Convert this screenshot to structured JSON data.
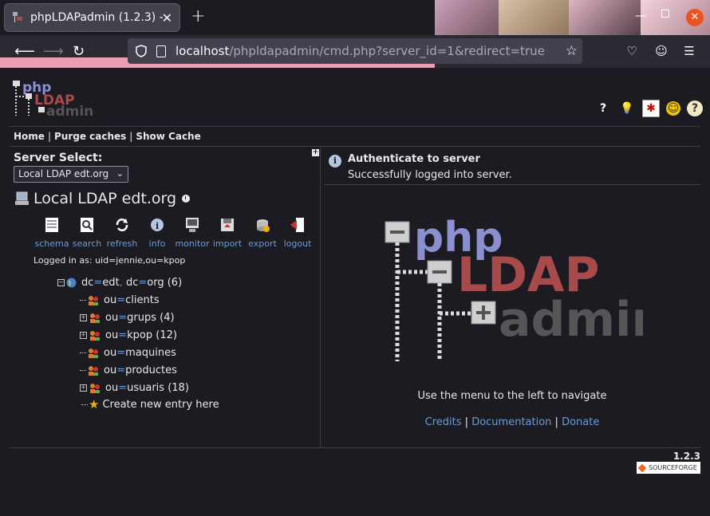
{
  "browser": {
    "tab_title": "phpLDAPadmin (1.2.3) -",
    "url_host": "localhost",
    "url_path": "/phpldapadmin/cmd.php?server_id=1&redirect=true"
  },
  "header": {
    "menu": [
      "Home",
      "Purge caches",
      "Show Cache"
    ]
  },
  "left": {
    "server_select_label": "Server Select:",
    "server_select_value": "Local LDAP edt.org",
    "server_name": "Local LDAP edt.org",
    "actions": [
      "schema",
      "search",
      "refresh",
      "info",
      "monitor",
      "import",
      "export",
      "logout"
    ],
    "logged_in": "Logged in as: uid=jennie,ou=kpop",
    "tree": {
      "root": {
        "a": "dc",
        "b": "edt",
        "c": "dc",
        "d": "org",
        "count": "(6)"
      },
      "items": [
        {
          "attr": "ou",
          "val": "clients",
          "count": ""
        },
        {
          "attr": "ou",
          "val": "grups",
          "count": "(4)"
        },
        {
          "attr": "ou",
          "val": "kpop",
          "count": "(12)"
        },
        {
          "attr": "ou",
          "val": "maquines",
          "count": ""
        },
        {
          "attr": "ou",
          "val": "productes",
          "count": ""
        },
        {
          "attr": "ou",
          "val": "usuaris",
          "count": "(18)"
        }
      ],
      "create": "Create new entry here"
    }
  },
  "right": {
    "auth_title": "Authenticate to server",
    "auth_msg": "Successfully logged into server.",
    "nav_hint": "Use the menu to the left to navigate",
    "links": [
      "Credits",
      "Documentation",
      "Donate"
    ]
  },
  "footer": {
    "version": "1.2.3",
    "sourceforge": "SOURCEFORGE"
  },
  "colors": {
    "link": "#6b9bd6",
    "logo_php": "#8a8fd0",
    "logo_ldap": "#a94a4a",
    "logo_admin": "#555555"
  }
}
